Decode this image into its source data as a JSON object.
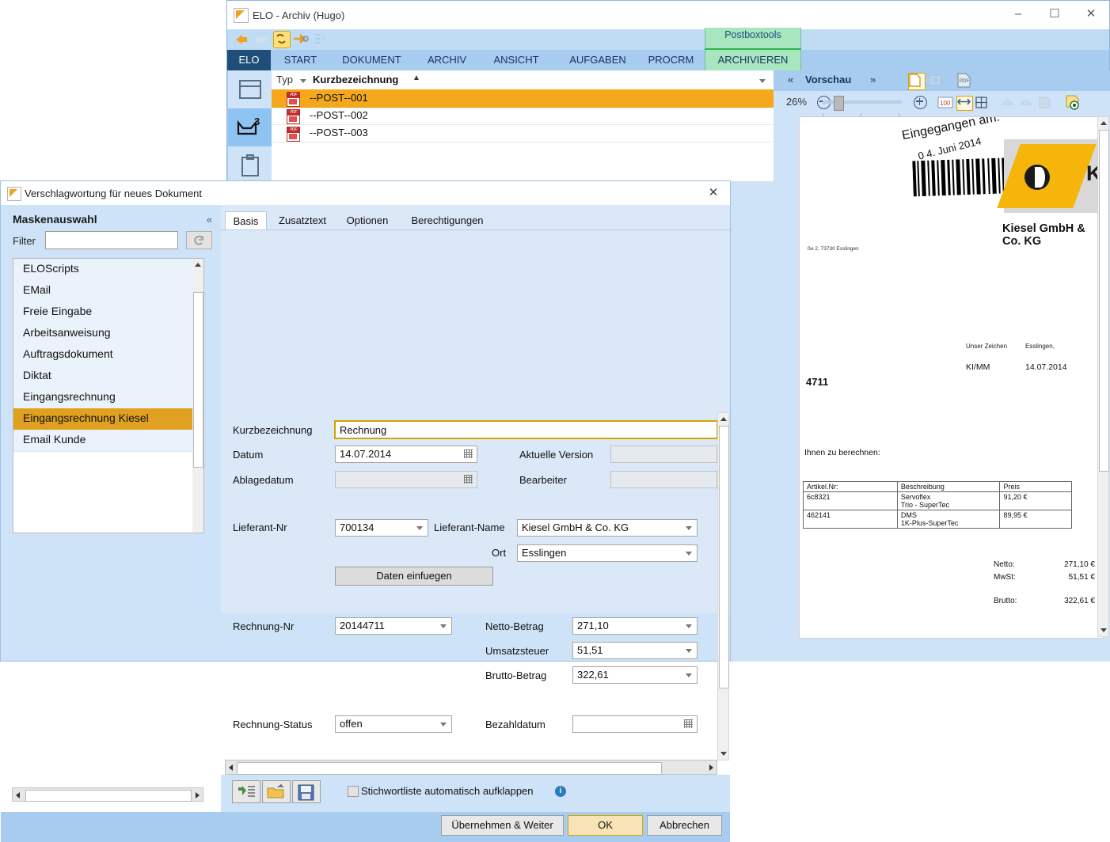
{
  "main_window": {
    "title": "ELO - Archiv (Hugo)",
    "controls": {
      "minimize": "–",
      "maximize": "☐",
      "close": "✕"
    },
    "ribbon_tabs": [
      "ELO",
      "START",
      "DOKUMENT",
      "ARCHIV",
      "ANSICHT",
      "AUFGABEN",
      "PROCRM"
    ],
    "context_group": {
      "label": "Postboxtools",
      "tab": "ARCHIVIEREN",
      "accent": "#2db34a"
    },
    "help_icon": "?",
    "left_bar": [
      {
        "name": "archive-icon",
        "badge": ""
      },
      {
        "name": "postbox-icon",
        "badge": "3",
        "selected": true
      },
      {
        "name": "clipboard-icon",
        "badge": ""
      }
    ]
  },
  "list": {
    "columns": [
      "Typ",
      "Kurzbezeichnung"
    ],
    "sort_indicator": "▲",
    "rows": [
      {
        "name": "--POST--001",
        "selected": true
      },
      {
        "name": "--POST--002",
        "selected": false
      },
      {
        "name": "--POST--003",
        "selected": false
      }
    ]
  },
  "preview": {
    "title": "Vorschau",
    "prev": "«",
    "next": "»",
    "zoom_level": "26%",
    "zoom_out": "−",
    "zoom_in": "+",
    "fit_100": "100"
  },
  "document": {
    "stamp_line1": "Eingegangen am:",
    "stamp_line2": "0 4. Juni  2014",
    "sender_address": "ße 2, 73730 Esslingen",
    "logo_text": "Kiesel",
    "company": "Kiesel GmbH & Co. KG",
    "ref_label": "Unser Zeichen",
    "ref_value": "KI/MM",
    "place_label": "Esslingen,",
    "date_value": "14.07.2014",
    "invoice_number_fragment": "4711",
    "intro": "Ihnen zu berechnen:",
    "table": {
      "headers": [
        "Artikel.Nr:",
        "Beschreibung",
        "Preis"
      ],
      "rows": [
        {
          "artikel": "6c8321",
          "beschreibung": "Servoflex\nTrio - SuperTec",
          "preis": "91,20 €"
        },
        {
          "artikel": "462141",
          "beschreibung": "DMS\n1K-Plus-SuperTec",
          "preis": "89,95 €"
        }
      ]
    },
    "totals": [
      {
        "label": "Netto:",
        "value": "271,10 €"
      },
      {
        "label": "MwSt:",
        "value": "51,51 €"
      },
      {
        "label": "Brutto:",
        "value": "322,61 €"
      }
    ]
  },
  "dialog": {
    "title": "Verschlagwortung für neues Dokument",
    "close": "✕",
    "mask_panel": {
      "title": "Maskenauswahl",
      "collapse": "«",
      "filter_label": "Filter",
      "filter_value": "",
      "filter_placeholder": "",
      "reset_icon": "↺",
      "items": [
        {
          "label": "ELOScripts",
          "selected": false
        },
        {
          "label": "EMail",
          "selected": false
        },
        {
          "label": "Freie Eingabe",
          "selected": false
        },
        {
          "label": "Arbeitsanweisung",
          "selected": false
        },
        {
          "label": "Auftragsdokument",
          "selected": false
        },
        {
          "label": "Diktat",
          "selected": false
        },
        {
          "label": "Eingangsrechnung",
          "selected": false
        },
        {
          "label": "Eingangsrechnung Kiesel",
          "selected": true
        },
        {
          "label": "Email Kunde",
          "selected": false
        }
      ]
    },
    "tabs": [
      {
        "label": "Basis",
        "active": true
      },
      {
        "label": "Zusatztext",
        "active": false
      },
      {
        "label": "Optionen",
        "active": false
      },
      {
        "label": "Berechtigungen",
        "active": false
      }
    ],
    "fields": {
      "kurzbezeichnung": {
        "label": "Kurzbezeichnung",
        "value": "Rechnung"
      },
      "datum": {
        "label": "Datum",
        "value": "14.07.2014"
      },
      "ablagedatum": {
        "label": "Ablagedatum",
        "value": ""
      },
      "aktuelle_version": {
        "label": "Aktuelle Version",
        "value": ""
      },
      "bearbeiter": {
        "label": "Bearbeiter",
        "value": ""
      },
      "lieferant_nr": {
        "label": "Lieferant-Nr",
        "value": "700134"
      },
      "lieferant_name": {
        "label": "Lieferant-Name",
        "value": "Kiesel GmbH & Co. KG"
      },
      "ort": {
        "label": "Ort",
        "value": "Esslingen"
      },
      "rechnung_nr": {
        "label": "Rechnung-Nr",
        "value": "20144711"
      },
      "netto_betrag": {
        "label": "Netto-Betrag",
        "value": "271,10"
      },
      "umsatzsteuer": {
        "label": "Umsatzsteuer",
        "value": "51,51"
      },
      "brutto_betrag": {
        "label": "Brutto-Betrag",
        "value": "322,61"
      },
      "rechnung_status": {
        "label": "Rechnung-Status",
        "value": "offen"
      },
      "bezahldatum": {
        "label": "Bezahldatum",
        "value": ""
      }
    },
    "insert_button": "Daten einfuegen",
    "checkbox": {
      "label": "Stichwortliste automatisch aufklappen",
      "checked": false
    },
    "info_icon": "i",
    "help_icon": "?",
    "buttons": {
      "apply_next": "Übernehmen & Weiter",
      "ok": "OK",
      "cancel": "Abbrechen"
    }
  }
}
